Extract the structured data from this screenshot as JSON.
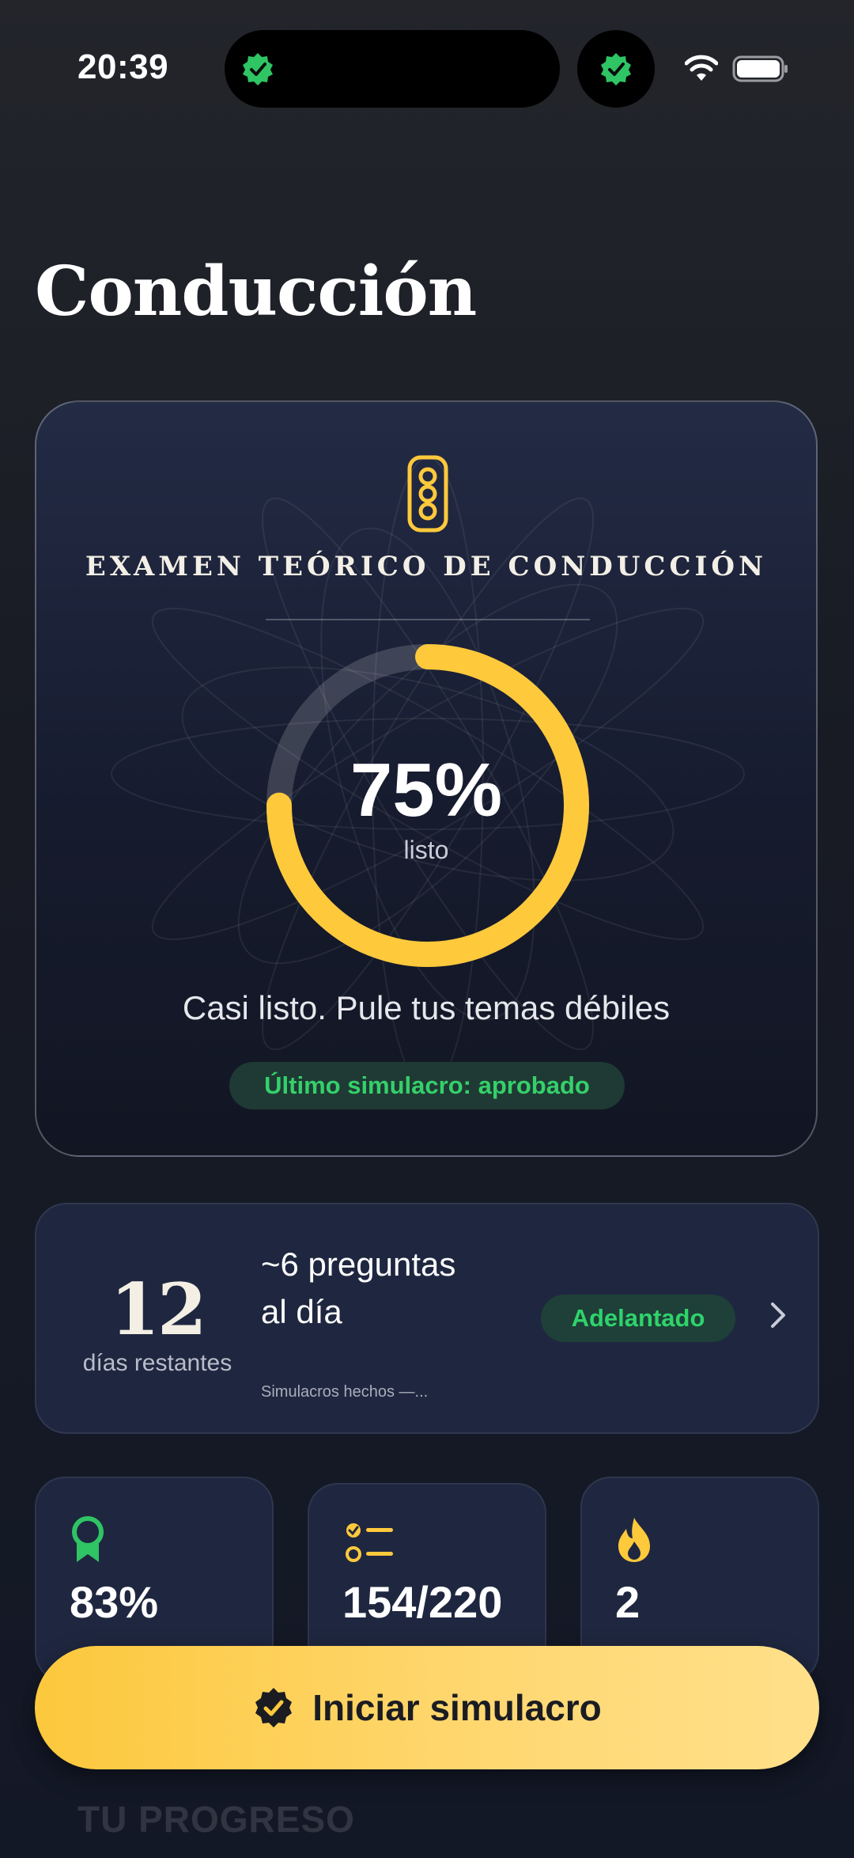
{
  "status_bar": {
    "time": "20:39"
  },
  "header": {
    "title": "Conducción"
  },
  "hero": {
    "exam_title": "EXAMEN TEÓRICO DE CONDUCCIÓN",
    "readiness_percent_label": "75%",
    "readiness_fraction": 0.75,
    "readiness_caption": "listo",
    "message": "Casi listo. Pule tus temas débiles",
    "last_mock_status": "Último simulacro: aprobado"
  },
  "plan": {
    "days_remaining": "12",
    "days_label": "días restantes",
    "questions_per_day": "~6 preguntas al día",
    "subtext": "Simulacros hechos —...",
    "pace_badge": "Adelantado"
  },
  "stats": [
    {
      "icon": "award-ribbon-icon",
      "value": "83%"
    },
    {
      "icon": "checklist-icon",
      "value": "154/220"
    },
    {
      "icon": "flame-icon",
      "value": "2"
    }
  ],
  "cta": {
    "label": "Iniciar simulacro"
  },
  "section": {
    "title": "TU PROGRESO"
  },
  "colors": {
    "accent_yellow": "#FFC93C",
    "success_green": "#35D06A",
    "card_bg": "#1F2740"
  }
}
